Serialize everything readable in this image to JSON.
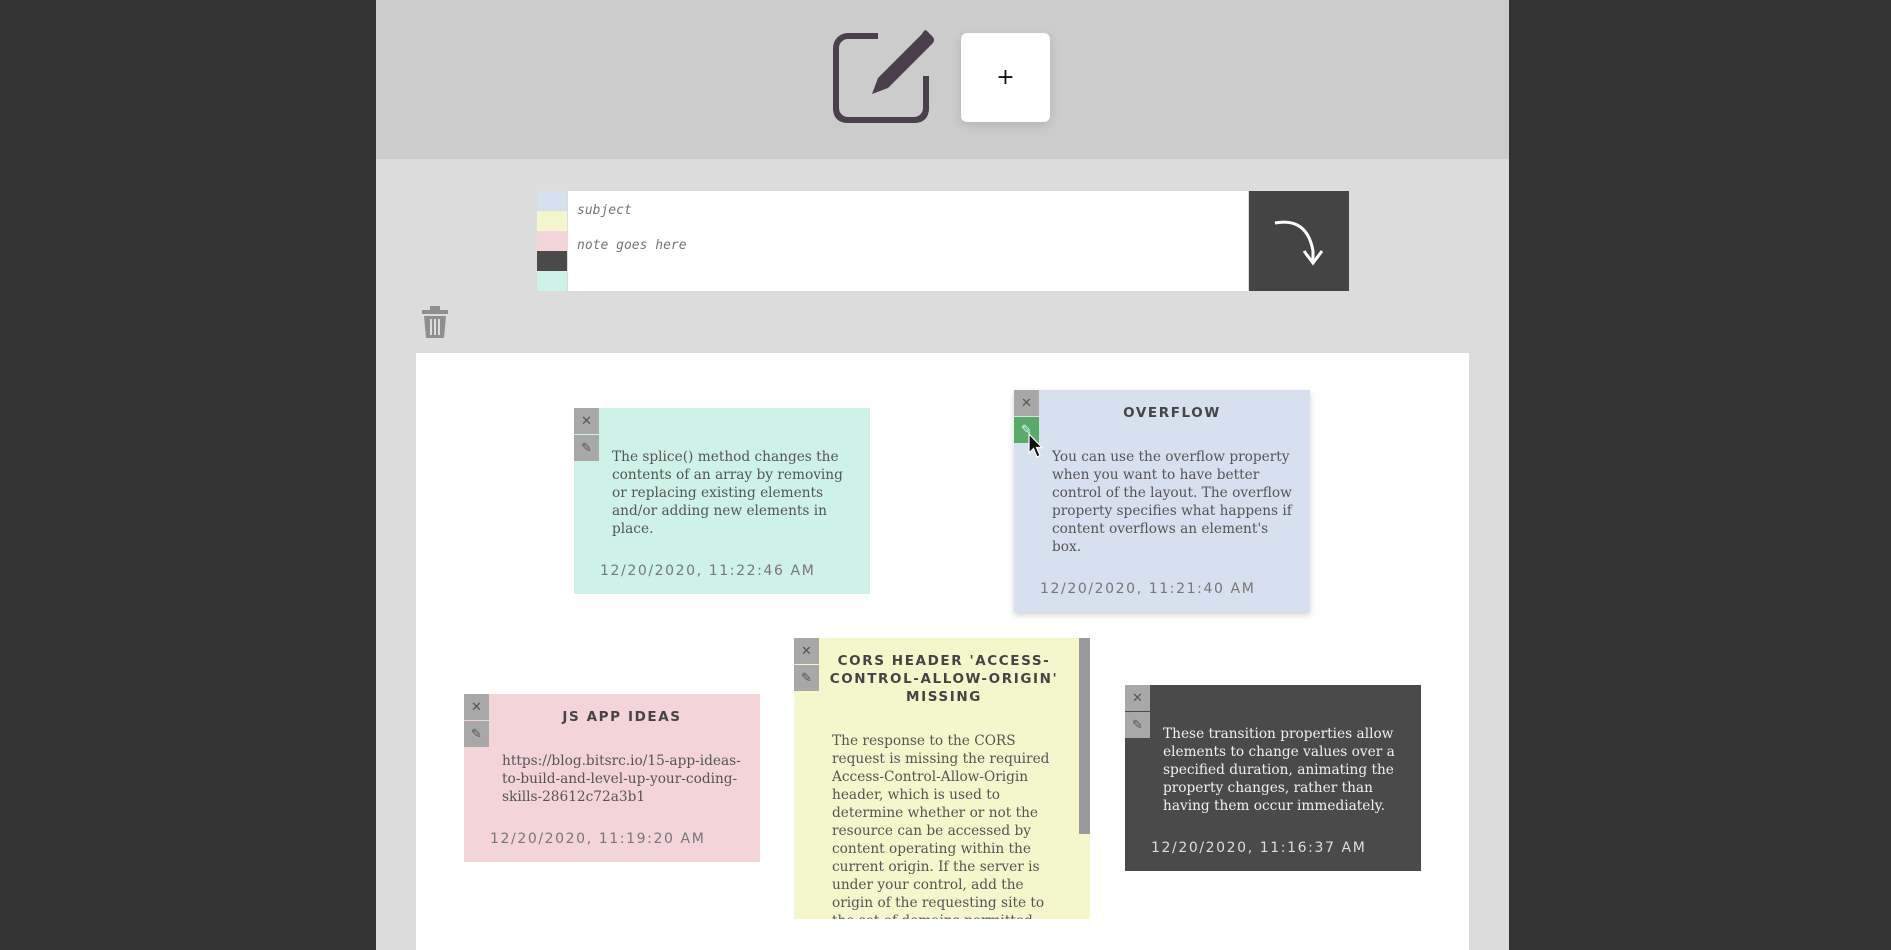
{
  "header": {
    "logo_icon": "edit-note-icon",
    "add_button_label": "+"
  },
  "compose": {
    "swatches": [
      {
        "name": "blue",
        "color": "#d6e0ef"
      },
      {
        "name": "yellow",
        "color": "#f3f6cc"
      },
      {
        "name": "pink",
        "color": "#f3d4d8"
      },
      {
        "name": "dark",
        "color": "#4a4a4a"
      },
      {
        "name": "mint",
        "color": "#cff2e8"
      }
    ],
    "subject_placeholder": "subject",
    "note_placeholder": "note goes here",
    "submit_icon": "arrow-turn-down-right-icon"
  },
  "toolbar": {
    "trash_icon": "trash-icon"
  },
  "notes": [
    {
      "title": "",
      "body": "The splice() method changes the contents of an array by removing or replacing existing elements and/or adding new elements in place.",
      "date": "12/20/2020, 11:22:46 AM",
      "color": "#cff2e8"
    },
    {
      "title": "OVERFLOW",
      "body": "You can use the overflow property when you want to have better control of the layout. The overflow property specifies what happens if content overflows an element's box.",
      "date": "12/20/2020, 11:21:40 AM",
      "color": "#d6e0ef"
    },
    {
      "title": "JS APP IDEAS",
      "body": "https://blog.bitsrc.io/15-app-ideas-to-build-and-level-up-your-coding-skills-28612c72a3b1",
      "date": "12/20/2020, 11:19:20 AM",
      "color": "#f3d4d8"
    },
    {
      "title": "CORS HEADER 'ACCESS-CONTROL-ALLOW-ORIGIN' MISSING",
      "body": "The response to the CORS request is missing the required Access-Control-Allow-Origin header, which is used to determine whether or not the resource can be accessed by content operating within the current origin. If the server is under your control, add the origin of the requesting site to the set of domains permitted",
      "date": "",
      "color": "#f4f6cc"
    },
    {
      "title": "",
      "body": "These transition properties allow elements to change values over a specified duration, animating the property changes, rather than having them occur immediately.",
      "date": "12/20/2020, 11:16:37 AM",
      "color": "#4a4a4a"
    }
  ],
  "note_controls": {
    "close_label": "✕",
    "edit_label": "✎"
  }
}
